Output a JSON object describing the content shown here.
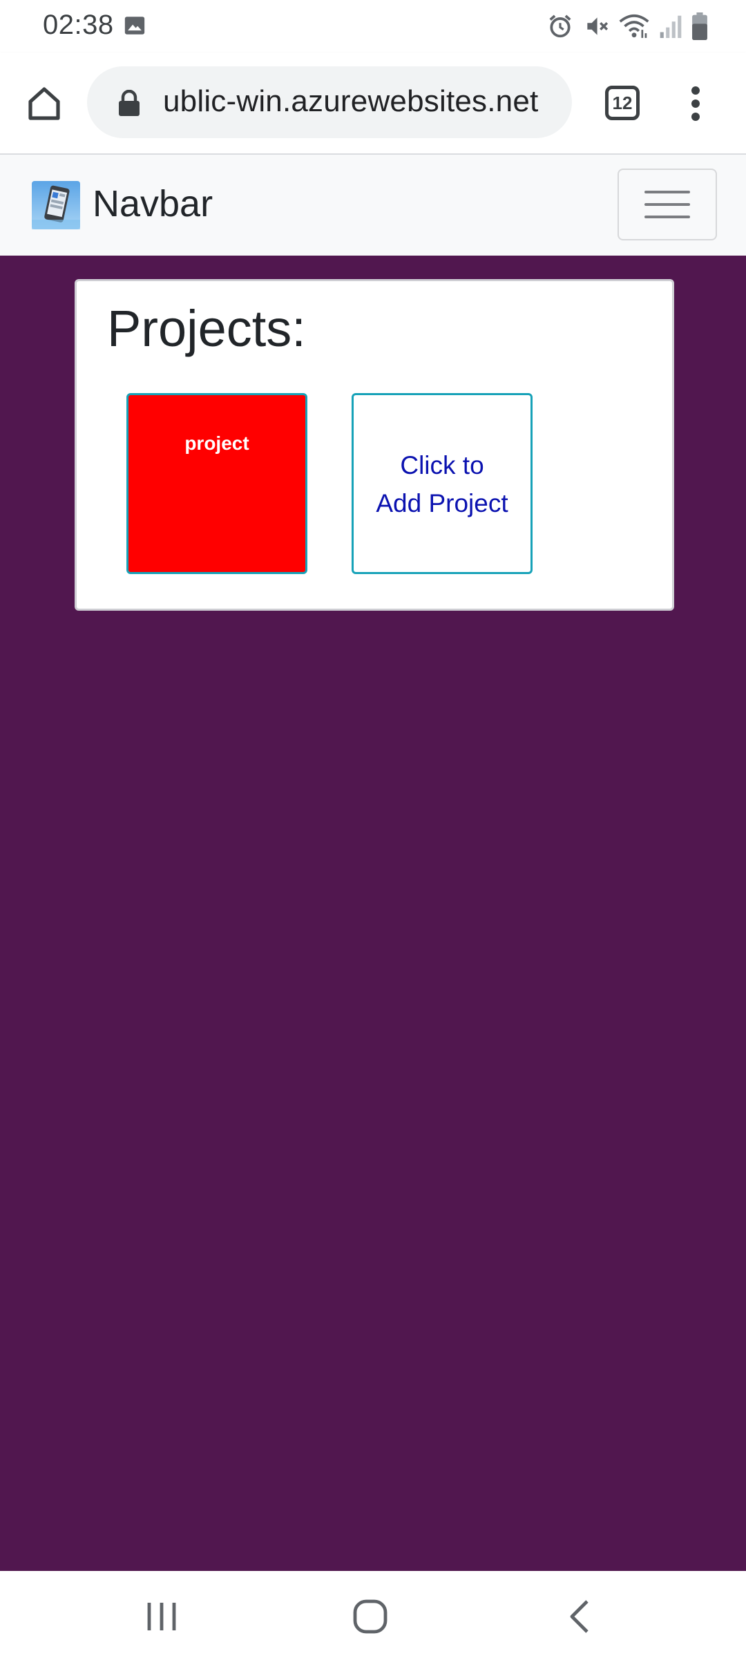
{
  "status_bar": {
    "time": "02:38",
    "icons": [
      "gallery-icon",
      "alarm-icon",
      "mute-icon",
      "wifi-icon",
      "signal-icon",
      "battery-icon"
    ]
  },
  "browser": {
    "url": "ublic-win.azurewebsites.net",
    "tab_count": "12",
    "icons": [
      "home-icon",
      "lock-icon",
      "more-vert-icon"
    ]
  },
  "navbar": {
    "brand": "Navbar",
    "bg_color": "#f8f9fa",
    "icons": [
      "brand-logo-icon",
      "hamburger-icon"
    ]
  },
  "main": {
    "bg_color": "#51174f",
    "projects_title": "Projects:",
    "projects": [
      {
        "label": "project",
        "color": "#ff0000"
      }
    ],
    "add_project": {
      "line1": "Click to",
      "line2": "Add Project"
    }
  },
  "system_nav": {
    "icons": [
      "recents-icon",
      "home-circle-icon",
      "back-icon"
    ]
  }
}
